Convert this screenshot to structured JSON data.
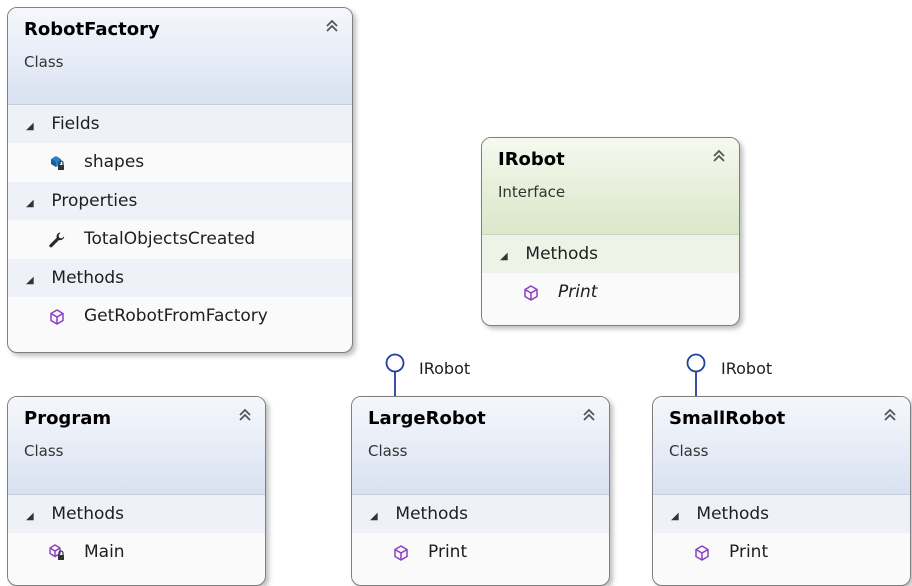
{
  "shapes": {
    "robot_factory": {
      "name": "RobotFactory",
      "stereotype": "Class",
      "groups": [
        {
          "label": "Fields",
          "members": [
            {
              "name": "shapes",
              "icon": "private-field-icon"
            }
          ]
        },
        {
          "label": "Properties",
          "members": [
            {
              "name": "TotalObjectsCreated",
              "icon": "property-wrench-icon"
            }
          ]
        },
        {
          "label": "Methods",
          "members": [
            {
              "name": "GetRobotFromFactory",
              "icon": "method-cube-icon"
            }
          ]
        }
      ]
    },
    "irobot": {
      "name": "IRobot",
      "stereotype": "Interface",
      "groups": [
        {
          "label": "Methods",
          "members": [
            {
              "name": "Print",
              "icon": "method-cube-icon",
              "italic": true
            }
          ]
        }
      ]
    },
    "program": {
      "name": "Program",
      "stereotype": "Class",
      "groups": [
        {
          "label": "Methods",
          "members": [
            {
              "name": "Main",
              "icon": "private-method-icon"
            }
          ]
        }
      ]
    },
    "large_robot": {
      "name": "LargeRobot",
      "stereotype": "Class",
      "implements": "IRobot",
      "groups": [
        {
          "label": "Methods",
          "members": [
            {
              "name": "Print",
              "icon": "method-cube-icon"
            }
          ]
        }
      ]
    },
    "small_robot": {
      "name": "SmallRobot",
      "stereotype": "Class",
      "implements": "IRobot",
      "groups": [
        {
          "label": "Methods",
          "members": [
            {
              "name": "Print",
              "icon": "method-cube-icon"
            }
          ]
        }
      ]
    }
  },
  "colors": {
    "method_icon": "#8a3fc4",
    "field_icon": "#2f7fc6",
    "lollipop": "#1f3fa0",
    "class_header": "#dfe6f4",
    "interface_header": "#e2ecd3"
  }
}
